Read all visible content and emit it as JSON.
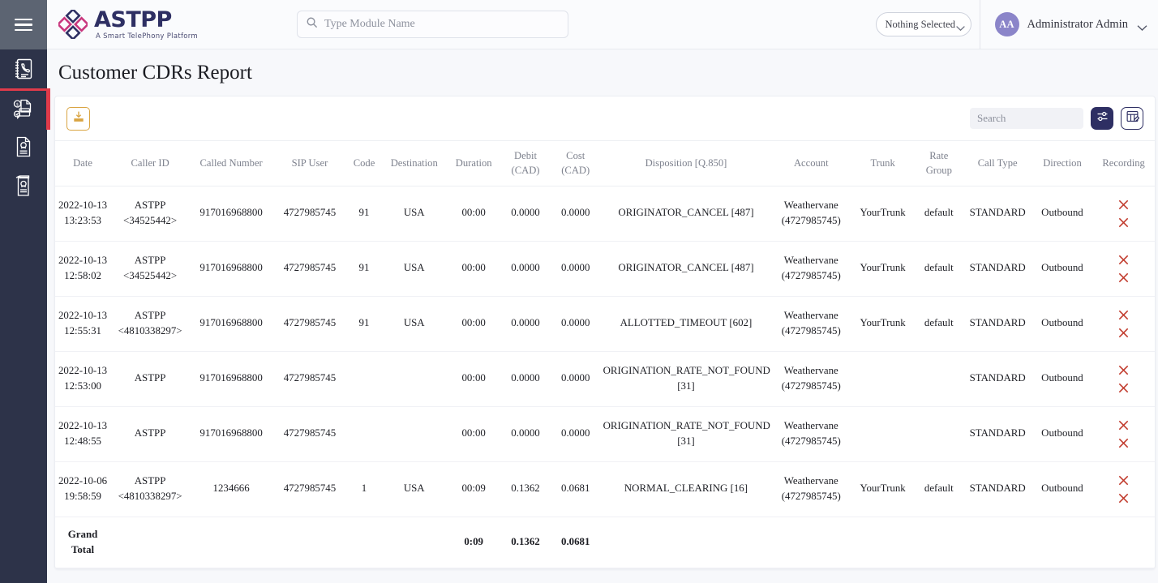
{
  "app": {
    "logo_name": "ASTPP",
    "logo_tagline": "A Smart TelePhony Platform",
    "accent_navy": "#2e2f63",
    "accent_red": "#e03b4a",
    "accent_orange": "#d9a441",
    "avatar_color": "#8b85c9"
  },
  "header": {
    "menu_icon": "hamburger-icon",
    "search_placeholder": "Type Module Name",
    "search_value": "",
    "search_icon": "search-icon",
    "select_label": "Nothing Selected",
    "select_chevron": "chevron-down-icon",
    "avatar_initials": "AA",
    "user_name": "Administrator Admin",
    "user_chevron": "chevron-down-icon"
  },
  "sidebar": {
    "items": [
      {
        "name": "sidebar-item-phonebook",
        "icon": "phonebook-icon",
        "active": false
      },
      {
        "name": "sidebar-item-billing",
        "icon": "invoice-card-icon",
        "active": true
      },
      {
        "name": "sidebar-item-document",
        "icon": "document-user-icon",
        "active": false
      },
      {
        "name": "sidebar-item-reports",
        "icon": "clipboard-report-icon",
        "active": false
      }
    ]
  },
  "page": {
    "title": "Customer CDRs Report"
  },
  "toolbar": {
    "download_icon": "download-icon",
    "search_placeholder": "Search",
    "search_value": "",
    "filter_icon": "sliders-icon",
    "columns_icon": "table-edit-icon"
  },
  "table": {
    "columns": [
      "Date",
      "Caller ID",
      "Called Number",
      "SIP User",
      "Code",
      "Destination",
      "Duration",
      "Debit (CAD)",
      "Cost (CAD)",
      "Disposition [Q.850]",
      "Account",
      "Trunk",
      "Rate Group",
      "Call Type",
      "Direction",
      "Recording"
    ],
    "rows": [
      {
        "date": "2022-10-13 13:23:53",
        "caller_id": "ASTPP <34525442>",
        "called_number": "917016968800",
        "sip_user": "4727985745",
        "code": "91",
        "destination": "USA",
        "duration": "00:00",
        "debit": "0.0000",
        "cost": "0.0000",
        "disposition": "ORIGINATOR_CANCEL [487]",
        "account": "Weathervane (4727985745)",
        "trunk": "YourTrunk",
        "rate_group": "default",
        "call_type": "STANDARD",
        "direction": "Outbound",
        "recording": "unavailable"
      },
      {
        "date": "2022-10-13 12:58:02",
        "caller_id": "ASTPP <34525442>",
        "called_number": "917016968800",
        "sip_user": "4727985745",
        "code": "91",
        "destination": "USA",
        "duration": "00:00",
        "debit": "0.0000",
        "cost": "0.0000",
        "disposition": "ORIGINATOR_CANCEL [487]",
        "account": "Weathervane (4727985745)",
        "trunk": "YourTrunk",
        "rate_group": "default",
        "call_type": "STANDARD",
        "direction": "Outbound",
        "recording": "unavailable"
      },
      {
        "date": "2022-10-13 12:55:31",
        "caller_id": "ASTPP <4810338297>",
        "called_number": "917016968800",
        "sip_user": "4727985745",
        "code": "91",
        "destination": "USA",
        "duration": "00:00",
        "debit": "0.0000",
        "cost": "0.0000",
        "disposition": "ALLOTTED_TIMEOUT [602]",
        "account": "Weathervane (4727985745)",
        "trunk": "YourTrunk",
        "rate_group": "default",
        "call_type": "STANDARD",
        "direction": "Outbound",
        "recording": "unavailable"
      },
      {
        "date": "2022-10-13 12:53:00",
        "caller_id": "ASTPP",
        "called_number": "917016968800",
        "sip_user": "4727985745",
        "code": "",
        "destination": "",
        "duration": "00:00",
        "debit": "0.0000",
        "cost": "0.0000",
        "disposition": "ORIGINATION_RATE_NOT_FOUND [31]",
        "account": "Weathervane (4727985745)",
        "trunk": "",
        "rate_group": "",
        "call_type": "STANDARD",
        "direction": "Outbound",
        "recording": "unavailable"
      },
      {
        "date": "2022-10-13 12:48:55",
        "caller_id": "ASTPP",
        "called_number": "917016968800",
        "sip_user": "4727985745",
        "code": "",
        "destination": "",
        "duration": "00:00",
        "debit": "0.0000",
        "cost": "0.0000",
        "disposition": "ORIGINATION_RATE_NOT_FOUND [31]",
        "account": "Weathervane (4727985745)",
        "trunk": "",
        "rate_group": "",
        "call_type": "STANDARD",
        "direction": "Outbound",
        "recording": "unavailable"
      },
      {
        "date": "2022-10-06 19:58:59",
        "caller_id": "ASTPP <4810338297>",
        "called_number": "1234666",
        "sip_user": "4727985745",
        "code": "1",
        "destination": "USA",
        "duration": "00:09",
        "debit": "0.1362",
        "cost": "0.0681",
        "disposition": "NORMAL_CLEARING [16]",
        "account": "Weathervane (4727985745)",
        "trunk": "YourTrunk",
        "rate_group": "default",
        "call_type": "STANDARD",
        "direction": "Outbound",
        "recording": "unavailable"
      }
    ],
    "grand_total": {
      "label": "Grand Total",
      "duration": "0:09",
      "debit": "0.1362",
      "cost": "0.0681"
    }
  }
}
